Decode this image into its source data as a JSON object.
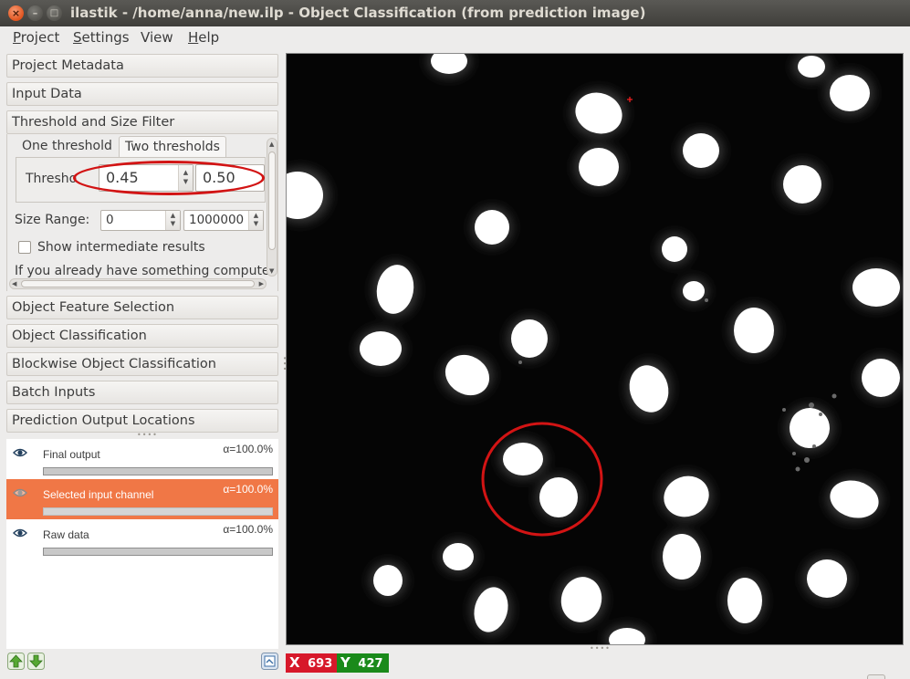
{
  "window": {
    "title": "ilastik - /home/anna/new.ilp - Object Classification (from prediction image)",
    "close_glyph": "×",
    "min_glyph": "–",
    "max_glyph": "□"
  },
  "menu": {
    "project": {
      "mnemonic": "P",
      "rest": "roject"
    },
    "settings": {
      "mnemonic": "S",
      "rest": "ettings"
    },
    "view": {
      "pre": "V",
      "rest": "iew"
    },
    "help": {
      "mnemonic": "H",
      "rest": "elp"
    }
  },
  "applets": {
    "project_metadata": "Project Metadata",
    "input_data": "Input Data",
    "threshold_and_size": "Threshold and Size Filter",
    "object_feature_selection": "Object Feature Selection",
    "object_classification": "Object Classification",
    "blockwise_object_classification": "Blockwise Object Classification",
    "batch_inputs": "Batch Inputs",
    "prediction_output_locations": "Prediction Output Locations"
  },
  "threshold_panel": {
    "tab_one": "One threshold",
    "tab_two": "Two thresholds",
    "active_tab": "Two thresholds",
    "threshold_label": "Thresho",
    "threshold_low": "0.45",
    "threshold_high": "0.50",
    "size_range_label": "Size Range:",
    "size_min": "0",
    "size_max": "1000000",
    "show_intermediate_label": "Show intermediate results",
    "show_intermediate_checked": false,
    "hint_text": "If you already have something computed,"
  },
  "layers": [
    {
      "name": "Final output",
      "alpha": "α=100.0%",
      "selected": false
    },
    {
      "name": "Selected input channel",
      "alpha": "α=100.0%",
      "selected": true
    },
    {
      "name": "Raw data",
      "alpha": "α=100.0%",
      "selected": false
    }
  ],
  "status": {
    "x_label": "X",
    "x_value": "693",
    "y_label": "Y",
    "y_value": "427",
    "x_color": "#d7182a",
    "y_color": "#1a8a1a"
  },
  "colors": {
    "accent_selected": "#f07746",
    "annotation": "#d21414",
    "viewer_background": "#050505"
  },
  "icons": [
    "eye-icon",
    "move-layer-up-icon",
    "move-layer-down-icon",
    "layer-options-icon"
  ]
}
